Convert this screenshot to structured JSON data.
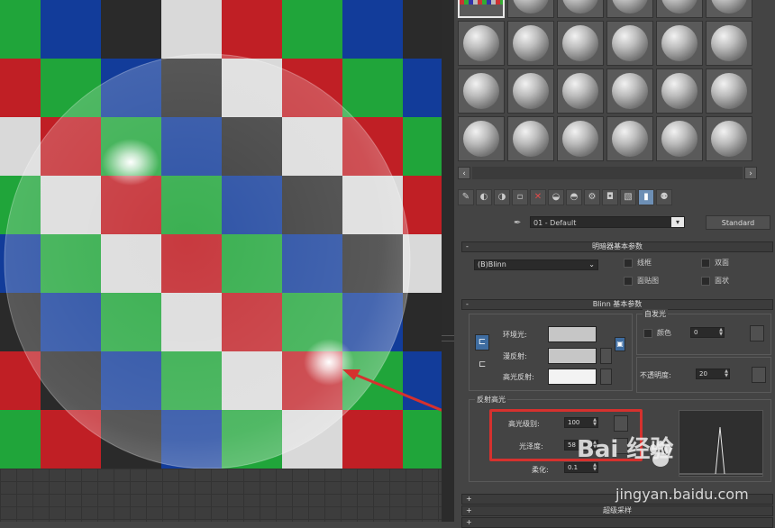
{
  "viewport": {
    "checker_colors": {
      "red": "#c01f25",
      "green": "#20a53a",
      "blue": "#123c9a",
      "white": "#d9d9d9",
      "dark": "#2a2a2a"
    },
    "checker_rows": [
      [
        "green",
        "blue",
        "dark",
        "white",
        "red",
        "green",
        "blue",
        "dark"
      ],
      [
        "red",
        "green",
        "blue",
        "dark",
        "white",
        "red",
        "green",
        "blue"
      ],
      [
        "white",
        "red",
        "green",
        "blue",
        "dark",
        "white",
        "red",
        "green"
      ],
      [
        "green",
        "white",
        "red",
        "green",
        "blue",
        "dark",
        "white",
        "red"
      ],
      [
        "blue",
        "green",
        "white",
        "red",
        "green",
        "blue",
        "dark",
        "white"
      ],
      [
        "dark",
        "blue",
        "green",
        "white",
        "red",
        "green",
        "blue",
        "dark"
      ],
      [
        "red",
        "dark",
        "blue",
        "green",
        "white",
        "red",
        "green",
        "blue"
      ],
      [
        "green",
        "red",
        "dark",
        "blue",
        "green",
        "white",
        "red",
        "green"
      ]
    ]
  },
  "material_editor": {
    "sample_slots_rows": 4,
    "sample_slots_cols": 6,
    "scroll_left": "‹",
    "scroll_right": "›",
    "toolbar_icons": [
      "get-material-icon",
      "put-to-scene-icon",
      "assign-to-selection-icon",
      "reset-icon",
      "delete-icon",
      "make-unique-icon",
      "put-to-library-icon",
      "material-id-icon",
      "show-in-viewport-icon",
      "show-end-result-icon",
      "go-to-parent-icon",
      "go-forward-icon"
    ],
    "material_name": "01 - Default",
    "material_type": "Standard",
    "shader_rollout": {
      "toggle": "-",
      "title": "明暗器基本参数",
      "shader": "(B)Blinn",
      "checkboxes": [
        {
          "label": "线框"
        },
        {
          "label": "双面"
        },
        {
          "label": "面贴图"
        },
        {
          "label": "面状"
        }
      ]
    },
    "blinn_rollout": {
      "toggle": "-",
      "title": "Blinn 基本参数",
      "self_illum_title": "自发光",
      "color_label": "颜色",
      "self_illum_value": "0",
      "ambient_label": "环境光:",
      "diffuse_label": "漫反射:",
      "specular_label": "高光反射:",
      "opacity_label": "不透明度:",
      "opacity_value": "20",
      "lock_top": "⊏",
      "lock_bottom": "⊏",
      "swatch_colors": {
        "ambient": "#c6c6c6",
        "diffuse": "#c6c6c6",
        "specular": "#f3f3f3"
      },
      "specular_highlights_title": "反射高光",
      "specular_level_label": "高光级别:",
      "specular_level_value": "100",
      "glossiness_label": "光泽度:",
      "glossiness_value": "58",
      "soften_label": "柔化:",
      "soften_value": "0.1"
    },
    "bottom_rollouts": [
      {
        "toggle": "+",
        "title": ""
      },
      {
        "toggle": "+",
        "title": "超级采样"
      },
      {
        "toggle": "+",
        "title": ""
      }
    ]
  },
  "watermark": {
    "text": "Bai 经验",
    "url": "jingyan.baidu.com"
  }
}
